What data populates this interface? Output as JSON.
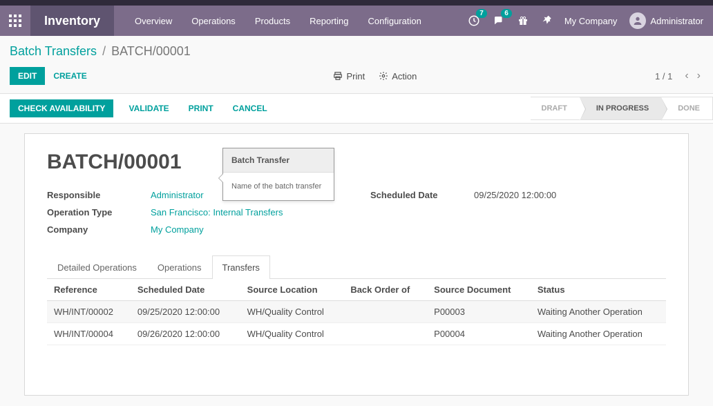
{
  "navbar": {
    "brand": "Inventory",
    "menu": [
      "Overview",
      "Operations",
      "Products",
      "Reporting",
      "Configuration"
    ],
    "clock_badge": "7",
    "chat_badge": "6",
    "company": "My Company",
    "user": "Administrator"
  },
  "breadcrumb": {
    "parent": "Batch Transfers",
    "current": "BATCH/00001"
  },
  "cp": {
    "edit": "EDIT",
    "create": "CREATE",
    "print": "Print",
    "action": "Action",
    "pager": "1 / 1"
  },
  "statusbar": {
    "check": "CHECK AVAILABILITY",
    "validate": "VALIDATE",
    "print": "PRINT",
    "cancel": "CANCEL",
    "stages": {
      "draft": "DRAFT",
      "in_progress": "IN PROGRESS",
      "done": "DONE"
    }
  },
  "record": {
    "title": "BATCH/00001",
    "tooltip_hdr": "Batch Transfer",
    "tooltip_body": "Name of the batch transfer",
    "labels": {
      "responsible": "Responsible",
      "operation_type": "Operation Type",
      "company": "Company",
      "scheduled_date": "Scheduled Date"
    },
    "values": {
      "responsible": "Administrator",
      "operation_type": "San Francisco: Internal Transfers",
      "company": "My Company",
      "scheduled_date": "09/25/2020 12:00:00"
    }
  },
  "tabs": {
    "detailed": "Detailed Operations",
    "operations": "Operations",
    "transfers": "Transfers"
  },
  "table": {
    "headers": {
      "reference": "Reference",
      "scheduled": "Scheduled Date",
      "source_loc": "Source Location",
      "back_order": "Back Order of",
      "source_doc": "Source Document",
      "status": "Status"
    },
    "rows": [
      {
        "reference": "WH/INT/00002",
        "scheduled": "09/25/2020 12:00:00",
        "source_loc": "WH/Quality Control",
        "back_order": "",
        "source_doc": "P00003",
        "status": "Waiting Another Operation"
      },
      {
        "reference": "WH/INT/00004",
        "scheduled": "09/26/2020 12:00:00",
        "source_loc": "WH/Quality Control",
        "back_order": "",
        "source_doc": "P00004",
        "status": "Waiting Another Operation"
      }
    ]
  }
}
